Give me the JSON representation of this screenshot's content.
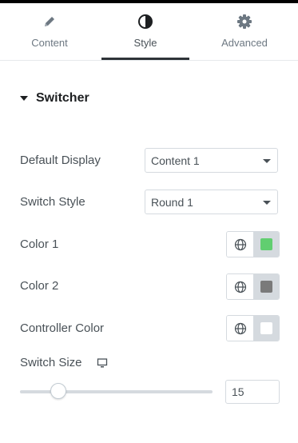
{
  "tabs": [
    {
      "label": "Content",
      "icon": "pencil-icon",
      "active": false
    },
    {
      "label": "Style",
      "icon": "half-circle-icon",
      "active": true
    },
    {
      "label": "Advanced",
      "icon": "gear-icon",
      "active": false
    }
  ],
  "section": {
    "title": "Switcher",
    "expanded": true
  },
  "default_display": {
    "label": "Default Display",
    "value": "Content 1"
  },
  "switch_style": {
    "label": "Switch Style",
    "value": "Round 1"
  },
  "colors": [
    {
      "label": "Color 1",
      "swatch": "#61ce70"
    },
    {
      "label": "Color 2",
      "swatch": "#7a7a7a"
    },
    {
      "label": "Controller Color",
      "swatch": "#ffffff"
    }
  ],
  "switch_size": {
    "label": "Switch Size",
    "value": "15",
    "device_icon": "desktop-icon",
    "slider_fraction": 0.2
  }
}
